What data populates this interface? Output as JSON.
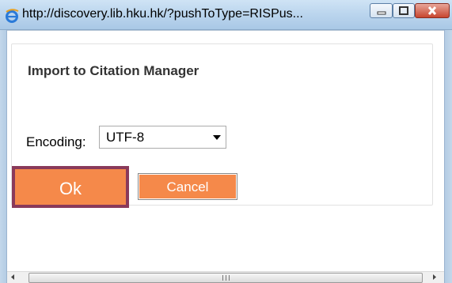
{
  "window": {
    "title": "http://discovery.lib.hku.hk/?pushToType=RISPus..."
  },
  "dialog": {
    "heading": "Import to Citation Manager",
    "encoding_label": "Encoding:",
    "encoding_value": "UTF-8",
    "ok_label": "Ok",
    "cancel_label": "Cancel"
  },
  "colors": {
    "button_orange": "#f5894a",
    "ok_highlight_border": "#8a3a5a",
    "titlebar": "#bcd6ee"
  },
  "icons": [
    "ie-icon",
    "minimize-icon",
    "maximize-icon",
    "close-icon",
    "chevron-down-icon",
    "scroll-left-icon",
    "scroll-right-icon"
  ]
}
